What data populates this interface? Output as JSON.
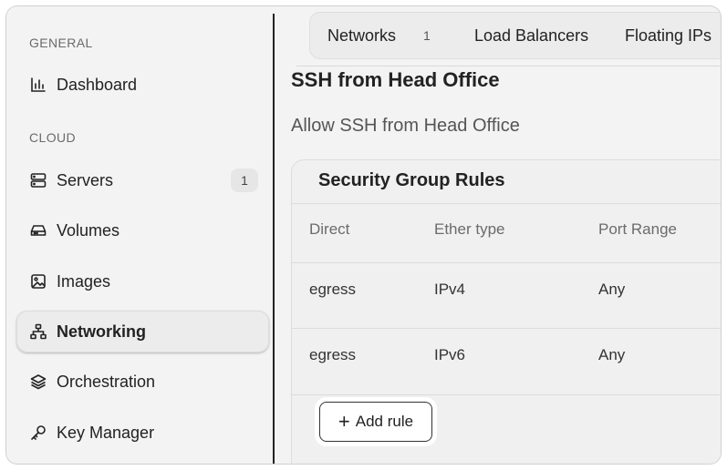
{
  "sidebar": {
    "sections": [
      {
        "label": "GENERAL"
      },
      {
        "label": "CLOUD"
      }
    ],
    "items": [
      {
        "label": "Dashboard",
        "icon": "bar-chart-icon"
      },
      {
        "label": "Servers",
        "icon": "server-icon",
        "badge": "1"
      },
      {
        "label": "Volumes",
        "icon": "hard-drive-icon"
      },
      {
        "label": "Images",
        "icon": "image-icon"
      },
      {
        "label": "Networking",
        "icon": "network-icon",
        "active": true
      },
      {
        "label": "Orchestration",
        "icon": "layers-icon"
      },
      {
        "label": "Key Manager",
        "icon": "key-icon"
      }
    ]
  },
  "tabs": [
    {
      "label": "Networks",
      "count": "1"
    },
    {
      "label": "Load Balancers"
    },
    {
      "label": "Floating IPs"
    }
  ],
  "page": {
    "title": "SSH from Head Office",
    "description": "Allow SSH from Head Office"
  },
  "rules_panel": {
    "title": "Security Group Rules",
    "columns": [
      "Direct",
      "Ether type",
      "Port Range"
    ],
    "rows": [
      [
        "egress",
        "IPv4",
        "Any"
      ],
      [
        "egress",
        "IPv6",
        "Any"
      ]
    ],
    "add_button_label": "Add rule"
  }
}
